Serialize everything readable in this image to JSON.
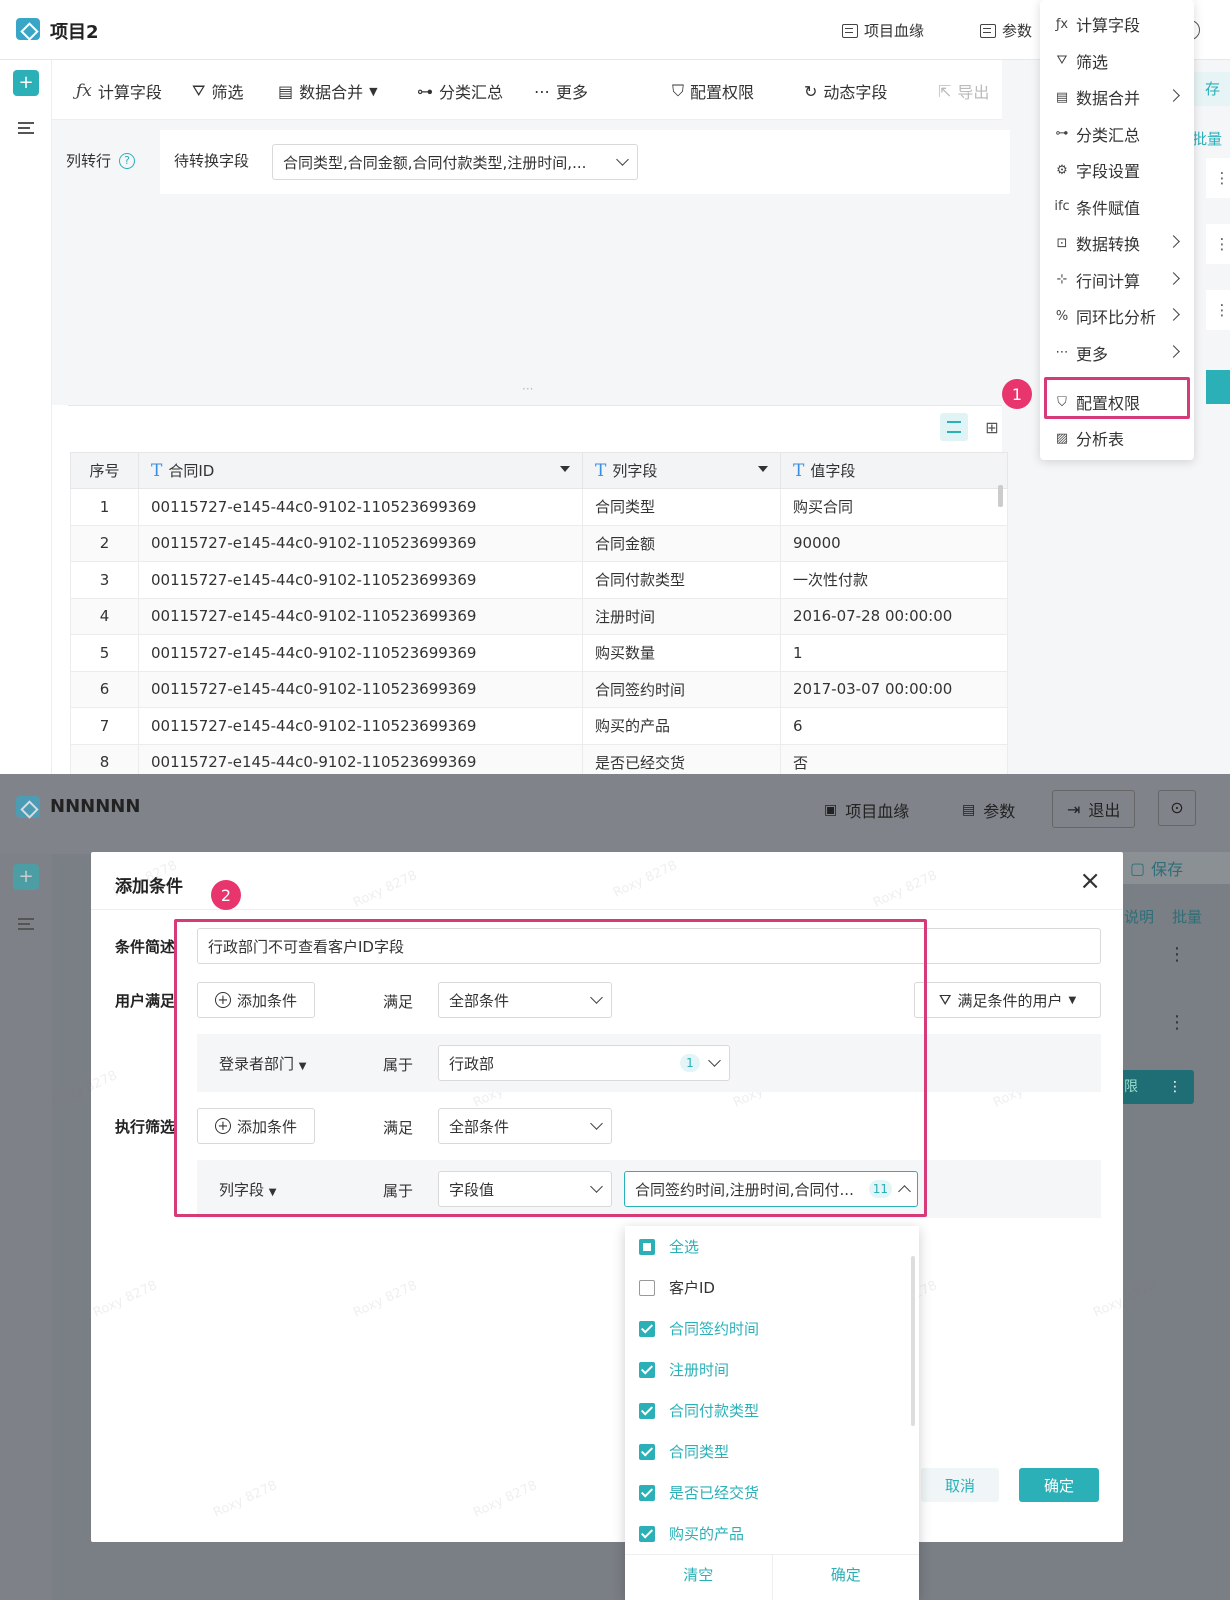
{
  "top": {
    "title": "项目2",
    "header_buttons": {
      "lineage": "项目血缘",
      "params": "参数"
    },
    "toolbar": {
      "calc_field": "计算字段",
      "filter": "筛选",
      "data_merge": "数据合并",
      "group_summary": "分类汇总",
      "more": "更多",
      "config_permission": "配置权限",
      "dynamic_field": "动态字段",
      "export": "导出"
    },
    "config": {
      "step_label": "列转行",
      "field_label": "待转换字段",
      "field_value": "合同类型,合同金额,合同付款类型,注册时间,..."
    },
    "table": {
      "columns": [
        "序号",
        "合同ID",
        "列字段",
        "值字段"
      ],
      "rows": [
        [
          "1",
          "00115727-e145-44c0-9102-110523699369",
          "合同类型",
          "购买合同"
        ],
        [
          "2",
          "00115727-e145-44c0-9102-110523699369",
          "合同金额",
          "90000"
        ],
        [
          "3",
          "00115727-e145-44c0-9102-110523699369",
          "合同付款类型",
          "一次性付款"
        ],
        [
          "4",
          "00115727-e145-44c0-9102-110523699369",
          "注册时间",
          "2016-07-28 00:00:00"
        ],
        [
          "5",
          "00115727-e145-44c0-9102-110523699369",
          "购买数量",
          "1"
        ],
        [
          "6",
          "00115727-e145-44c0-9102-110523699369",
          "合同签约时间",
          "2017-03-07 00:00:00"
        ],
        [
          "7",
          "00115727-e145-44c0-9102-110523699369",
          "购买的产品",
          "6"
        ],
        [
          "8",
          "00115727-e145-44c0-9102-110523699369",
          "是否已经交货",
          "否"
        ]
      ]
    },
    "side_fragments": {
      "save": "存",
      "batch": "批量"
    },
    "menu": {
      "items": [
        "计算字段",
        "筛选",
        "数据合并",
        "分类汇总",
        "字段设置",
        "条件赋值",
        "数据转换",
        "行间计算",
        "同环比分析",
        "更多",
        "配置权限",
        "分析表"
      ]
    },
    "step_badge": "1"
  },
  "bottom": {
    "title": "NNNNNN",
    "header_buttons": {
      "lineage": "项目血缘",
      "params": "参数",
      "exit": "退出"
    },
    "side": {
      "save": "保存",
      "explain": "说明",
      "batch": "批量",
      "limit": "限"
    },
    "dialog": {
      "title": "添加条件",
      "close": "×",
      "desc_label": "条件简述",
      "desc_value": "行政部门不可查看客户ID字段",
      "user_label": "用户满足",
      "exec_label": "执行筛选",
      "add_condition": "添加条件",
      "satisfy": "满足",
      "all_conditions": "全部条件",
      "user_filter_btn": "满足条件的用户",
      "dept_field": "登录者部门",
      "belongs": "属于",
      "dept_value": "行政部",
      "dept_count": "1",
      "col_field": "列字段",
      "value_type": "字段值",
      "col_value": "合同签约时间,注册时间,合同付...",
      "col_count": "11",
      "cancel": "取消",
      "confirm": "确定"
    },
    "dropdown": {
      "options": [
        {
          "label": "全选",
          "checked": "partial"
        },
        {
          "label": "客户ID",
          "checked": "no"
        },
        {
          "label": "合同签约时间",
          "checked": "yes"
        },
        {
          "label": "注册时间",
          "checked": "yes"
        },
        {
          "label": "合同付款类型",
          "checked": "yes"
        },
        {
          "label": "合同类型",
          "checked": "yes"
        },
        {
          "label": "是否已经交货",
          "checked": "yes"
        },
        {
          "label": "购买的产品",
          "checked": "yes"
        }
      ],
      "clear": "清空",
      "ok": "确定"
    },
    "step_badge": "2",
    "watermark": "Roxy 8278"
  },
  "colors": {
    "accent": "#2bb0b8",
    "highlight": "#d63a78",
    "badge": "#e8356d"
  }
}
